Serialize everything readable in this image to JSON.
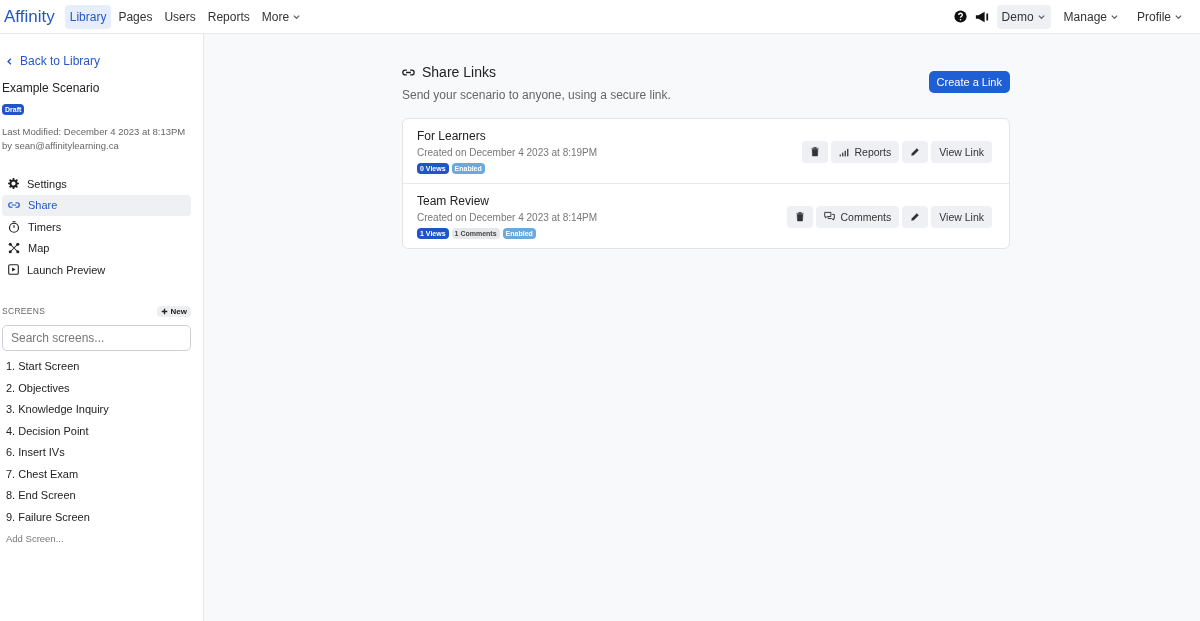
{
  "topbar": {
    "logo": "Affinity",
    "nav": [
      {
        "label": "Library",
        "selected": true,
        "dropdown": false
      },
      {
        "label": "Pages",
        "selected": false,
        "dropdown": false
      },
      {
        "label": "Users",
        "selected": false,
        "dropdown": false
      },
      {
        "label": "Reports",
        "selected": false,
        "dropdown": false
      },
      {
        "label": "More",
        "selected": false,
        "dropdown": true
      }
    ],
    "right_menus": [
      {
        "label": "Demo",
        "selected": true
      },
      {
        "label": "Manage",
        "selected": false
      },
      {
        "label": "Profile",
        "selected": false
      }
    ]
  },
  "sidebar": {
    "back_link": "Back to Library",
    "scenario_title": "Example Scenario",
    "status_badge": "Draft",
    "last_modified": "Last Modified: December 4 2023 at 8:13PM",
    "author": "by sean@affinitylearning.ca",
    "items": [
      {
        "kind": "settings",
        "label": "Settings",
        "selected": false
      },
      {
        "kind": "share",
        "label": "Share",
        "selected": true
      },
      {
        "kind": "timers",
        "label": "Timers",
        "selected": false
      },
      {
        "kind": "map",
        "label": "Map",
        "selected": false
      },
      {
        "kind": "preview",
        "label": "Launch Preview",
        "selected": false
      }
    ],
    "screens_heading": "SCREENS",
    "new_button": "New",
    "search": {
      "placeholder": "Search screens..."
    },
    "screens": [
      "1. Start Screen",
      "2. Objectives",
      "3. Knowledge Inquiry",
      "4. Decision Point",
      "6. Insert IVs",
      "7. Chest Exam",
      "8. End Screen",
      "9. Failure Screen"
    ],
    "add_screen": "Add Screen..."
  },
  "main": {
    "title": "Share Links",
    "subtitle": "Send your scenario to anyone, using a secure link.",
    "create_button": "Create a Link",
    "links": [
      {
        "name": "For Learners",
        "created": "Created on December 4 2023 at 8:19PM",
        "badges": [
          {
            "kind": "views",
            "text": "0 Views"
          },
          {
            "kind": "status",
            "text": "Enabled"
          }
        ],
        "action": {
          "kind": "reports",
          "label": "Reports"
        },
        "view_button": "View Link"
      },
      {
        "name": "Team Review",
        "created": "Created on December 4 2023 at 8:14PM",
        "badges": [
          {
            "kind": "views",
            "text": "1 Views"
          },
          {
            "kind": "comments",
            "text": "1 Comments"
          },
          {
            "kind": "status",
            "text": "Enabled"
          }
        ],
        "action": {
          "kind": "comments",
          "label": "Comments"
        },
        "view_button": "View Link"
      }
    ]
  }
}
